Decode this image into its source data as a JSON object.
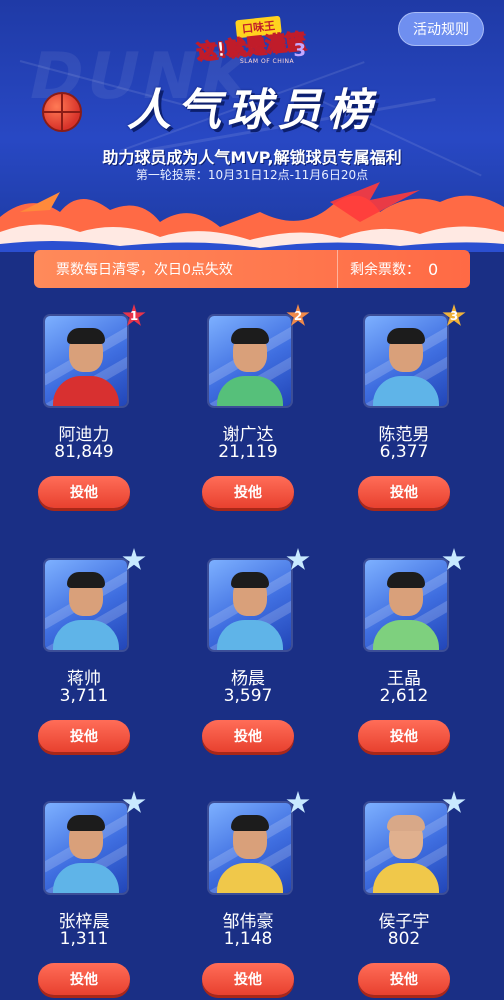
{
  "header": {
    "logo_main": "这!就是灌篮",
    "logo_badge": "口味王",
    "logo_number": "3",
    "logo_sub": "SLAM OF CHINA",
    "rules_button": "活动规则",
    "title": "人气球员榜",
    "subtitle": "助力球员成为人气MVP,解锁球员专属福利",
    "round_info": "第一轮投票：10月31日12点-11月6日20点"
  },
  "notice": {
    "text": "票数每日清零，次日0点失效",
    "remaining_label": "剩余票数：",
    "remaining_count": "0"
  },
  "players": [
    {
      "name": "阿迪力",
      "votes": "81,849",
      "rank": "1",
      "badge_color": "#e8344a",
      "jersey": "#d83030",
      "button": "投他"
    },
    {
      "name": "谢广达",
      "votes": "21,119",
      "rank": "2",
      "badge_color": "#f08a4a",
      "jersey": "#56c07a",
      "button": "投他"
    },
    {
      "name": "陈范男",
      "votes": "6,377",
      "rank": "3",
      "badge_color": "#f0b23a",
      "jersey": "#5fb4e8",
      "button": "投他"
    },
    {
      "name": "蒋帅",
      "votes": "3,711",
      "rank": "",
      "badge_color": "#c8e9ff",
      "jersey": "#5fb4e8",
      "button": "投他"
    },
    {
      "name": "杨晨",
      "votes": "3,597",
      "rank": "",
      "badge_color": "#c8e9ff",
      "jersey": "#5fb4e8",
      "button": "投他"
    },
    {
      "name": "王晶",
      "votes": "2,612",
      "rank": "",
      "badge_color": "#c8e9ff",
      "jersey": "#7ed07e",
      "button": "投他"
    },
    {
      "name": "张梓晨",
      "votes": "1,311",
      "rank": "",
      "badge_color": "#c8e9ff",
      "jersey": "#5fb4e8",
      "button": "投他"
    },
    {
      "name": "邹伟豪",
      "votes": "1,148",
      "rank": "",
      "badge_color": "#c8e9ff",
      "jersey": "#f0c84a",
      "button": "投他"
    },
    {
      "name": "侯子宇",
      "votes": "802",
      "rank": "",
      "badge_color": "#c8e9ff",
      "jersey": "#f0c84a",
      "button": "投他"
    }
  ],
  "colors": {
    "page_background": "#1a2f85",
    "accent": "#ff6a45",
    "vote_button": "#e8412f"
  }
}
